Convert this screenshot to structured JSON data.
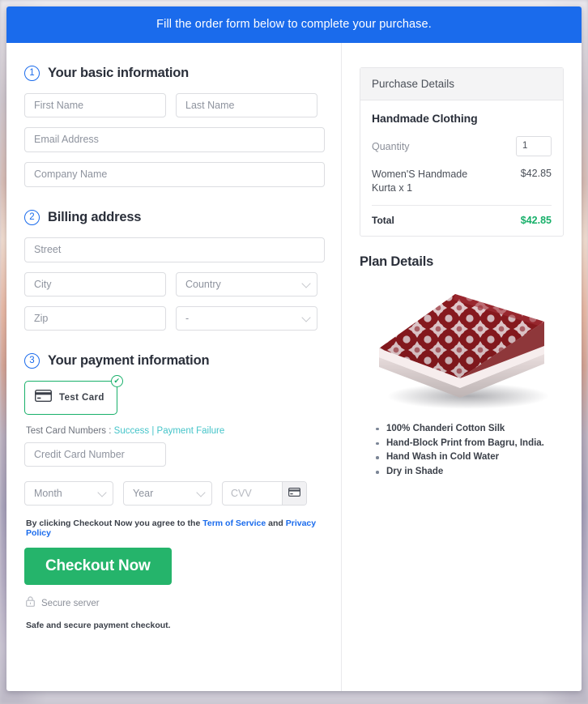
{
  "banner": {
    "text": "Fill the order form below to complete your purchase."
  },
  "sections": {
    "basic": {
      "number": "1",
      "title": "Your basic information"
    },
    "billing": {
      "number": "2",
      "title": "Billing address"
    },
    "payment": {
      "number": "3",
      "title": "Your payment information"
    }
  },
  "fields": {
    "first_name": "First Name",
    "last_name": "Last Name",
    "email": "Email Address",
    "company": "Company Name",
    "street": "Street",
    "city": "City",
    "country": "Country",
    "zip": "Zip",
    "state": "-",
    "credit_card_number": "Credit Card Number",
    "month": "Month",
    "year": "Year",
    "cvv": "CVV"
  },
  "payment_method": {
    "label": "Test  Card",
    "selected": true,
    "check_glyph": "✔",
    "border_color": "#18b06a"
  },
  "test_card_note": {
    "prefix": "Test Card Numbers :",
    "success_link": "Success",
    "separator": "|",
    "failure_link": "Payment Failure",
    "link_color": "#45c4c9"
  },
  "terms": {
    "prefix": "By clicking Checkout Now you agree to the",
    "terms_link": "Term of Service",
    "and": "and",
    "privacy_link": "Privacy Policy",
    "link_color": "#1a6bec"
  },
  "checkout": {
    "button_label": "Checkout Now",
    "button_color": "#25b46b",
    "secure_label": "Secure server",
    "safe_note": "Safe and secure payment checkout."
  },
  "purchase_details": {
    "panel_title": "Purchase Details",
    "product_name": "Handmade Clothing",
    "quantity_label": "Quantity",
    "quantity_value": "1",
    "line_item_name": "Women'S Handmade Kurta x 1",
    "line_item_price": "$42.85",
    "total_label": "Total",
    "total_value": "$42.85",
    "total_color": "#18b06a"
  },
  "plan_details": {
    "title": "Plan Details",
    "image_alt": "folded dark red floral block print fabric",
    "features": [
      "100% Chanderi Cotton Silk",
      "Hand-Block Print from Bagru, India.",
      "Hand Wash in Cold Water",
      "Dry in Shade"
    ]
  },
  "theme": {
    "banner_blue": "#1a6bec",
    "accent_green": "#18b06a",
    "link_teal": "#45c4c9"
  }
}
